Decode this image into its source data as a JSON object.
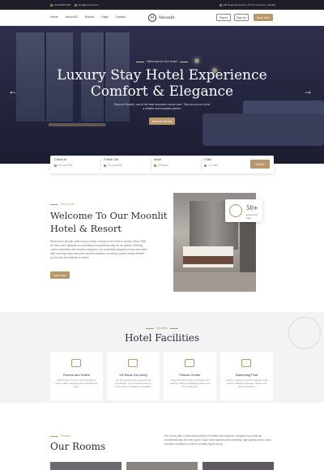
{
  "topbar": {
    "phone": "+1(234)567-890",
    "email": "hotel@moonlit.com",
    "address": "235 Segunda Avenue, 6th CA 4 Toronto, Canada"
  },
  "nav": {
    "menu": [
      "Home",
      "About US",
      "Rooms",
      "Page",
      "Contact"
    ],
    "logo_mark": "M",
    "logo_name": "Moonlit",
    "sign_in": "Sign in",
    "sign_up": "Sign Up",
    "book_now": "Book Now"
  },
  "hero": {
    "kicker": "Welcome to Our Hotel",
    "title_line1": "Luxury Stay Hotel Experience",
    "title_line2": "Comfort & Elegance",
    "description": "Discover Moonlit, one of the best decorative venue ever. They are proven to be a reliable and complete partner.",
    "cta": "Discover Rooms",
    "arrow_left": "←",
    "arrow_right": "→"
  },
  "booking": {
    "check_in": {
      "label": "Check In",
      "value": "15 Jun 2024"
    },
    "check_out": {
      "label": "Check Out",
      "value": "21 Jun 2024"
    },
    "adult": {
      "label": "Adult",
      "value": "2 Person"
    },
    "child": {
      "label": "Child",
      "value": "+1 Child"
    },
    "search": "Search"
  },
  "about": {
    "kicker": "About US",
    "title_line1": "Welcome To Our Moonlit",
    "title_line2": "Hotel & Resort",
    "text": "Welcome to Moonlit, where luxury meets comfort in the heart of canada. Since 1990, we have been dedicated to providing an exceptional stay for our guests, blending modern amenities with timeless elegance. Our beautifully designed rooms and suites offer stunning views and plush accommodations, ensuring a restful retreat whether you're here for business or leisure.",
    "cta": "Learn More",
    "badge_number": "50+",
    "badge_label": "Experience Staff"
  },
  "facilities": {
    "kicker": "Facilities",
    "title": "Hotel Facilities",
    "cards": [
      {
        "name": "Rooms and Suites",
        "icon": "bed-icon",
        "desc": "Varied types of rooms, from standard to luxury suites, equipped with essentials like beds."
      },
      {
        "name": "24-Hour Security",
        "icon": "shield-icon",
        "desc": "On-site security personnel and real surveillance. From standard to luxury suites. Secure storage for valuables."
      },
      {
        "name": "Fitness Center",
        "icon": "dumbbell-icon",
        "desc": "Equipped with exercise machines and weights. Offering massages, facials, and other treatments."
      },
      {
        "name": "Swimming Pool",
        "icon": "pool-icon",
        "desc": "Indoor or outdoor pools for relaxation and leisure. Offering massages, facials, and other treatments."
      }
    ]
  },
  "rooms": {
    "kicker": "Rooms",
    "title": "Our Rooms",
    "desc": "Our rooms offer a harmonious blend of comfort and elegance, designed to provide an exceptional stay for every guest. Each room features plush bedding, high-quality linens, and a selection of pillows to ensure a restful night's sleep."
  },
  "colors": {
    "accent": "#b8976a",
    "dark": "#2b2b38",
    "section_bg": "#f3f3f5"
  }
}
